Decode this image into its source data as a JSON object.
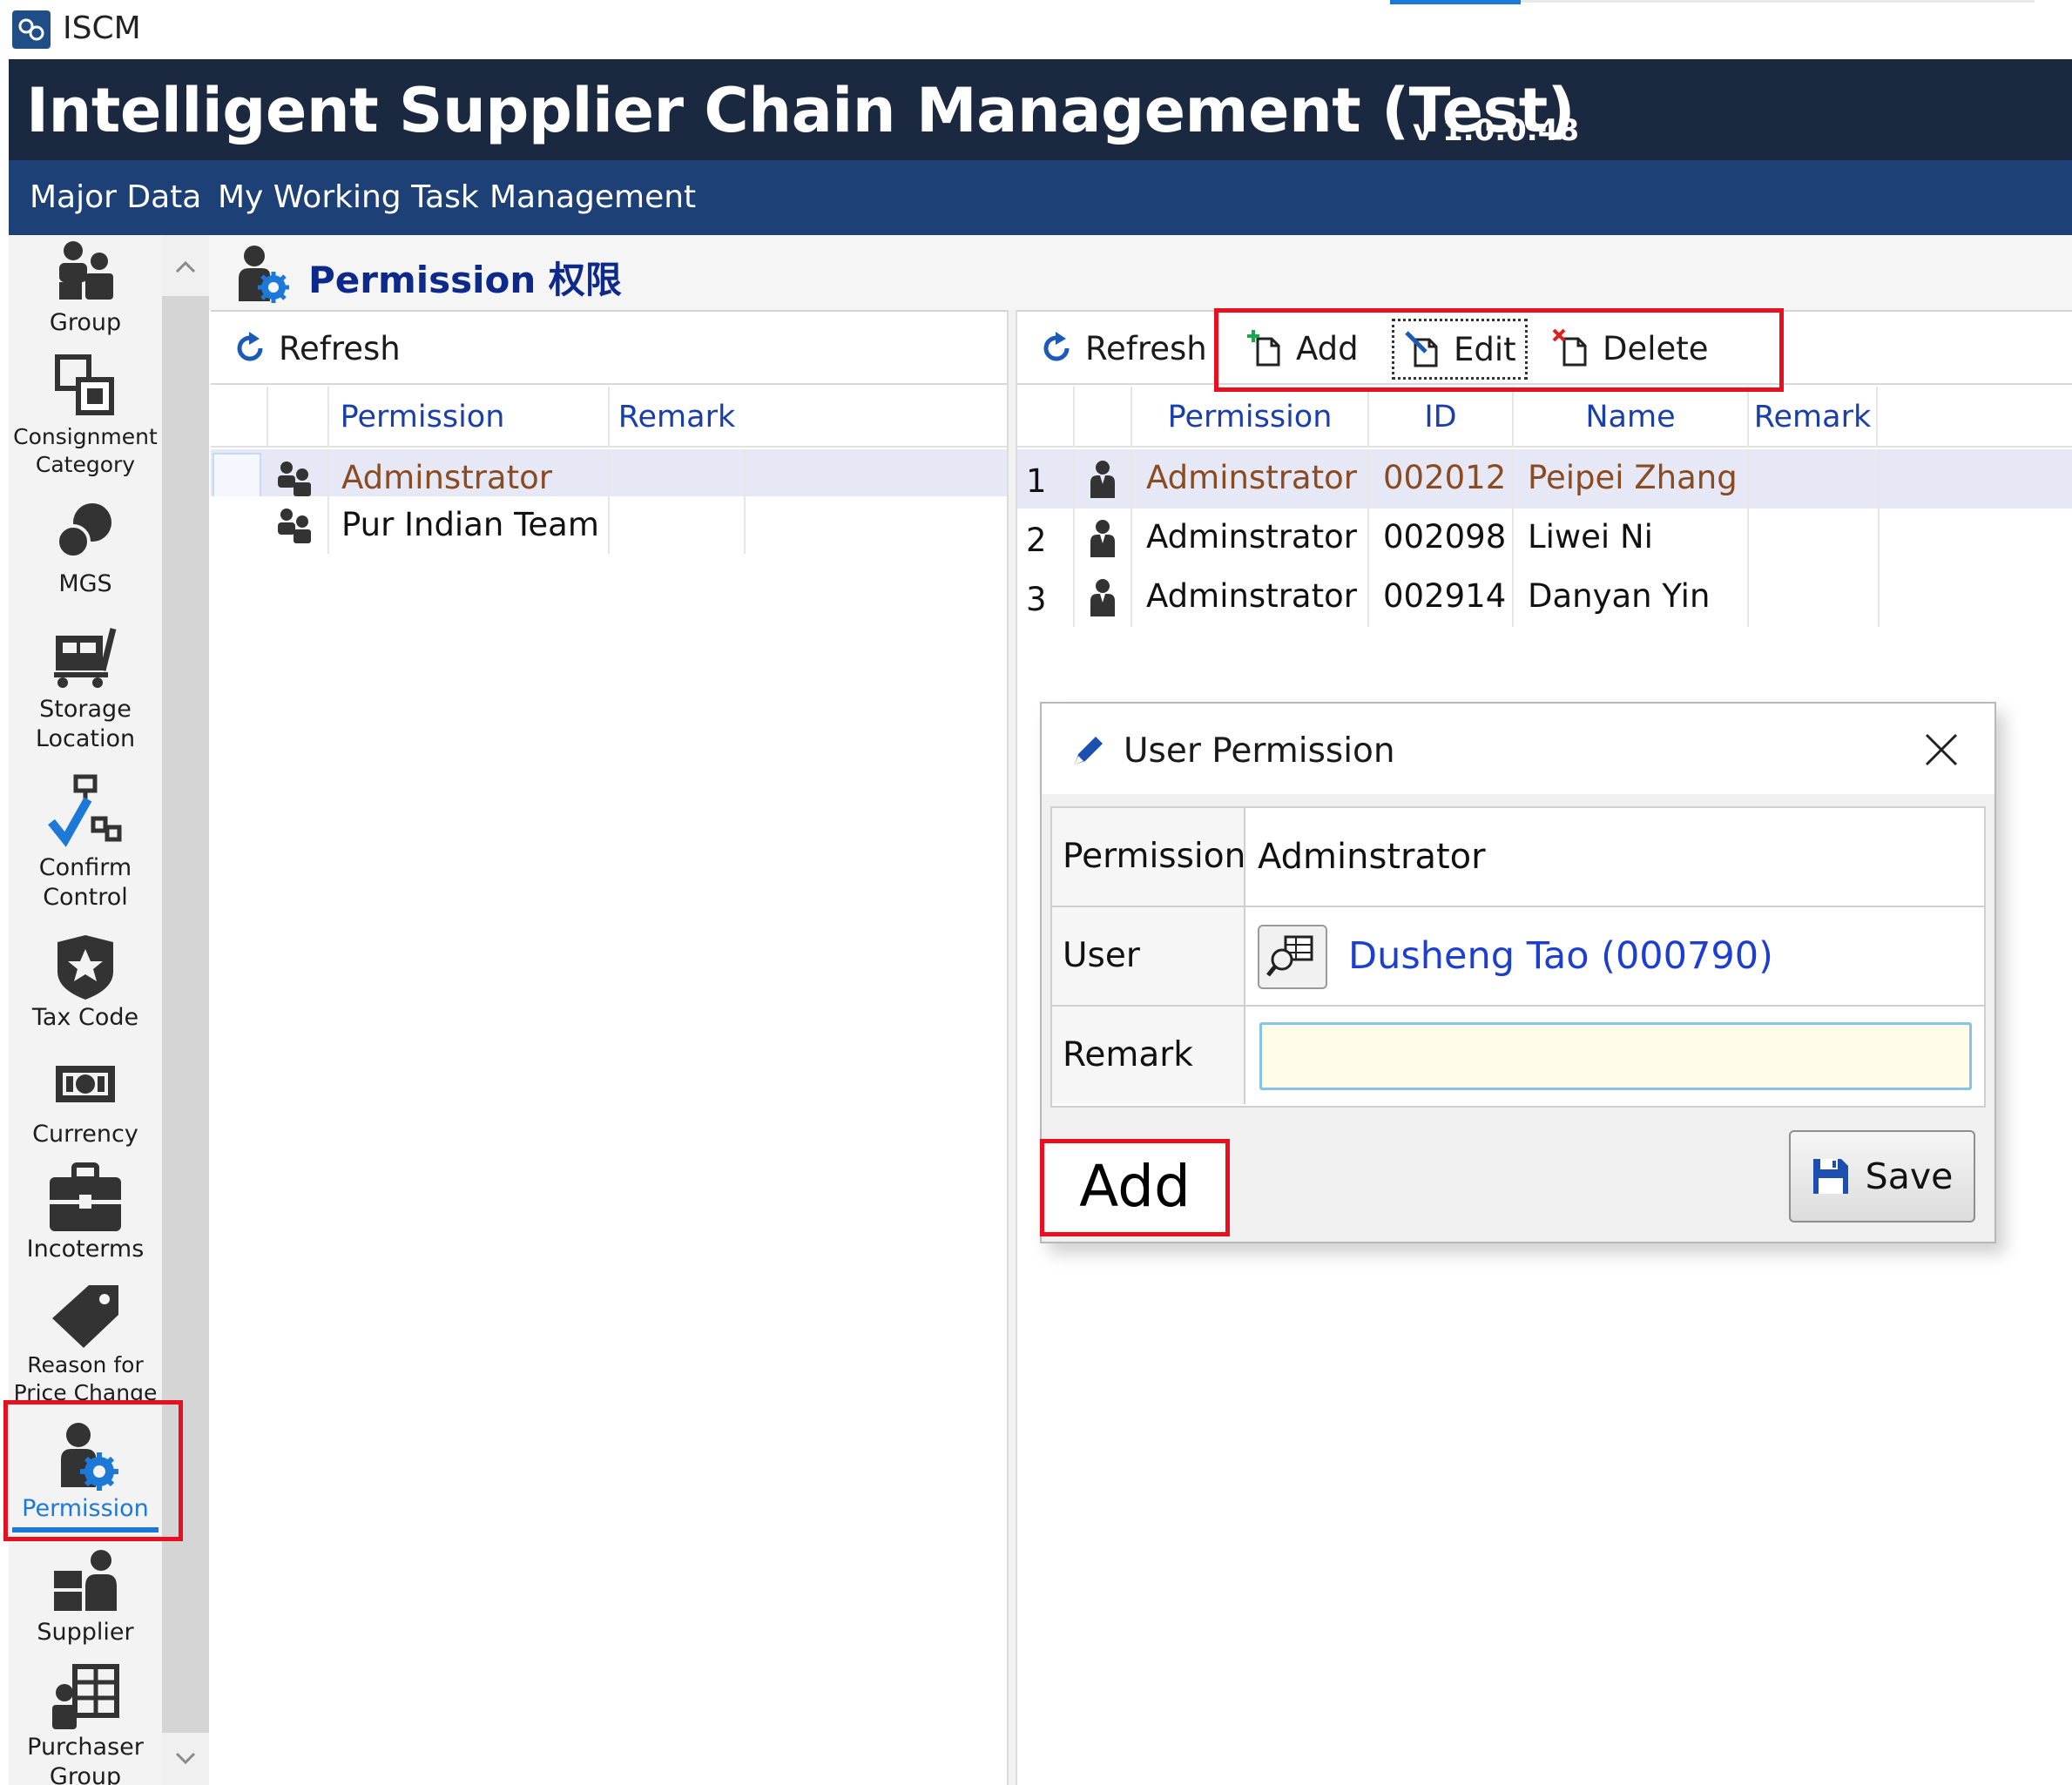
{
  "window": {
    "app_name": "ISCM"
  },
  "banner": {
    "title": "Intelligent Supplier Chain Management (Test)",
    "version": "v 1.0.0.48"
  },
  "menu": [
    "Major Data",
    "My Working Task",
    "Management"
  ],
  "sidebar": {
    "items": [
      {
        "label": "Group",
        "icon": "group-icon"
      },
      {
        "label": "Consignment Category",
        "icon": "consignment-icon"
      },
      {
        "label": "MGS",
        "icon": "mgs-icon"
      },
      {
        "label": "Storage Location",
        "icon": "storage-icon"
      },
      {
        "label": "Confirm Control",
        "icon": "confirm-control-icon"
      },
      {
        "label": "Tax Code",
        "icon": "tax-code-icon"
      },
      {
        "label": "Currency",
        "icon": "currency-icon"
      },
      {
        "label": "Incoterms",
        "icon": "incoterms-icon"
      },
      {
        "label": "Reason for Price Change",
        "icon": "price-tag-icon"
      },
      {
        "label": "Permission",
        "icon": "permission-icon",
        "active": true
      },
      {
        "label": "Supplier",
        "icon": "supplier-icon"
      },
      {
        "label": "Purchaser Group",
        "icon": "purchaser-group-icon"
      }
    ]
  },
  "page": {
    "title": "Permission 权限"
  },
  "left_panel": {
    "refresh_label": "Refresh",
    "columns": [
      "Permission",
      "Remark"
    ],
    "rows": [
      {
        "permission": "Adminstrator",
        "remark": "",
        "selected": true
      },
      {
        "permission": "Pur Indian Team",
        "remark": "",
        "selected": false
      }
    ]
  },
  "right_panel": {
    "refresh_label": "Refresh",
    "add_label": "Add",
    "edit_label": "Edit",
    "delete_label": "Delete",
    "columns": [
      "Permission",
      "ID",
      "Name",
      "Remark"
    ],
    "rows": [
      {
        "num": "1",
        "permission": "Adminstrator",
        "id": "002012",
        "name": "Peipei Zhang",
        "remark": "",
        "selected": true
      },
      {
        "num": "2",
        "permission": "Adminstrator",
        "id": "002098",
        "name": "Liwei Ni",
        "remark": "",
        "selected": false
      },
      {
        "num": "3",
        "permission": "Adminstrator",
        "id": "002914",
        "name": "Danyan Yin",
        "remark": "",
        "selected": false
      }
    ]
  },
  "dialog": {
    "title": "User Permission",
    "permission_label": "Permission",
    "permission_value": "Adminstrator",
    "user_label": "User",
    "user_value": "Dusheng Tao (000790)",
    "remark_label": "Remark",
    "remark_value": "",
    "save_label": "Save"
  },
  "annotation": {
    "caption": "Add"
  },
  "colors": {
    "banner": "#1b2940",
    "menubar": "#1d4076",
    "accent": "#1c79d8",
    "highlight": "#e8101e",
    "link": "#1c3fd0"
  }
}
